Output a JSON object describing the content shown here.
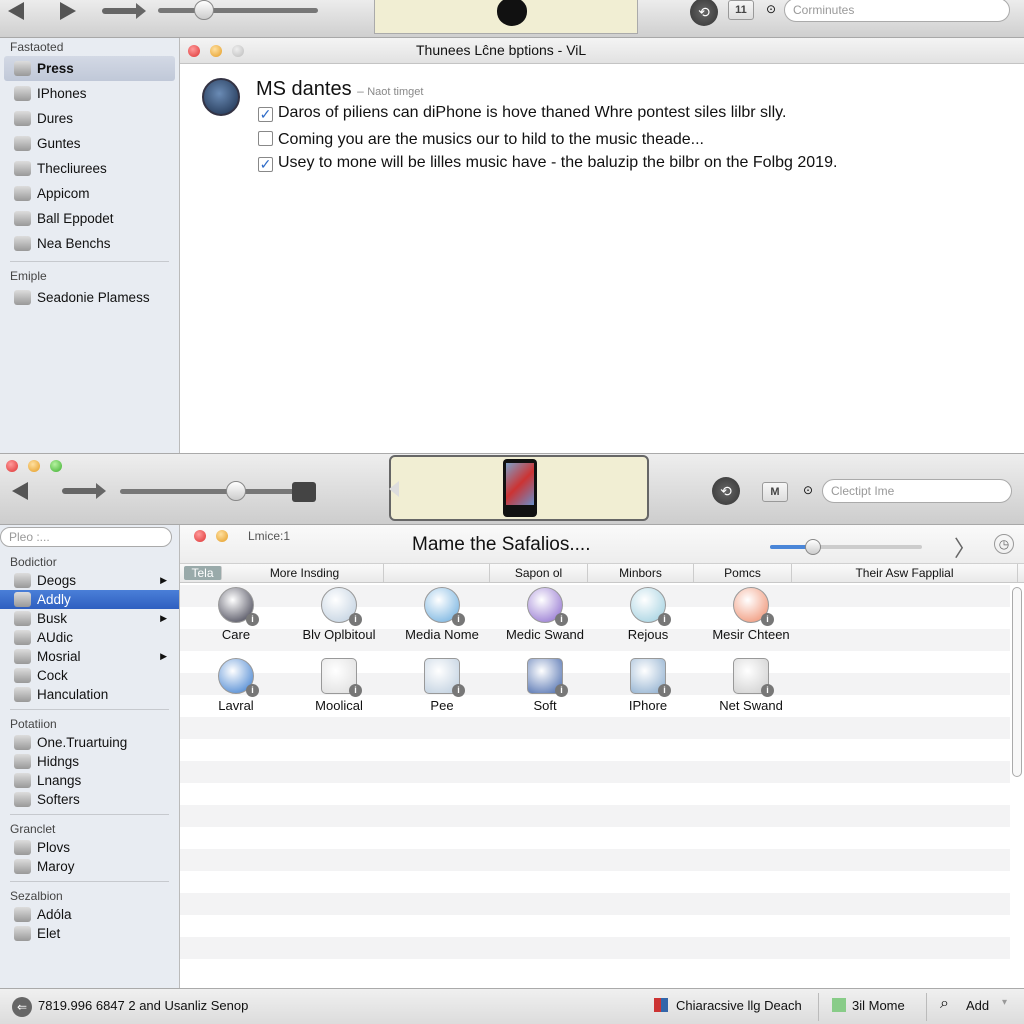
{
  "top_toolbar": {
    "search_placeholder": "Corminutes",
    "view_button_label": "11"
  },
  "sidebar_top": {
    "sections": [
      {
        "header": "Fastaoted",
        "items": [
          {
            "label": "Press",
            "icon": "drive-icon",
            "selected": true
          },
          {
            "label": "IPhones",
            "icon": "phone-icon"
          },
          {
            "label": "Dures",
            "icon": "bag-icon"
          },
          {
            "label": "Guntes",
            "icon": "chart-icon"
          },
          {
            "label": "Thecliurees",
            "icon": "inbox-icon"
          },
          {
            "label": "Appicom",
            "icon": "joystick-icon"
          },
          {
            "label": "Ball Eppodet",
            "icon": "camera-icon"
          },
          {
            "label": "Nea Benchs",
            "icon": "github-icon"
          }
        ]
      },
      {
        "header": "Emiple",
        "items": [
          {
            "label": "Seadonie Plamess",
            "icon": "dollar-icon"
          }
        ]
      }
    ]
  },
  "upper_window": {
    "title": "Thunees Lĉne bptions  -  ViL",
    "heading": "MS dantes",
    "subheading": "Naot timget",
    "options": [
      {
        "label": "Daros of piliens can diPhone is hove thaned Whre pontest siles lilbr slly.",
        "checked": true
      },
      {
        "label": "Coming you are the musics our to hild to the music theade...",
        "checked": false
      },
      {
        "label": "Usey to mone will be lilles music have - the baluzip the bilbr on the Folbg 2019.",
        "checked": true
      }
    ]
  },
  "lower_toolbar": {
    "search_placeholder": "Clectipt Ime",
    "view_button_label": "M"
  },
  "sidebar_bottom": {
    "search_placeholder": "Pleo :...",
    "sections": [
      {
        "header": "Bodictior",
        "items": [
          {
            "label": "Deogs",
            "icon": "keyboard-icon",
            "submenu": true
          },
          {
            "label": "Addly",
            "icon": "document-icon",
            "selected": true
          },
          {
            "label": "Busk",
            "icon": "box-icon",
            "submenu": true
          },
          {
            "label": "AUdic",
            "icon": "audio-icon"
          },
          {
            "label": "Mosrial",
            "icon": "disk-icon",
            "submenu": true
          },
          {
            "label": "Cock",
            "icon": "app-icon"
          },
          {
            "label": "Hanculation",
            "icon": "device-icon"
          }
        ]
      },
      {
        "header": "Potatiion",
        "items": [
          {
            "label": "One.Truartuing",
            "icon": "network-icon"
          },
          {
            "label": "Hidngs",
            "icon": "globe-icon"
          },
          {
            "label": "Lnangs",
            "icon": "display-icon"
          },
          {
            "label": "Softers",
            "icon": "folder-icon"
          }
        ]
      },
      {
        "header": "Granclet",
        "items": [
          {
            "label": "Plovs",
            "icon": "tower-icon"
          },
          {
            "label": "Maroy",
            "icon": "card-icon"
          }
        ]
      },
      {
        "header": "Sezalbion",
        "items": [
          {
            "label": "Adóla",
            "icon": "folder-icon"
          },
          {
            "label": "Elet",
            "icon": "location-pin-icon"
          }
        ]
      }
    ]
  },
  "lower_window": {
    "counter_label": "Lmice:1",
    "title": "Mame the Safalios....",
    "zoom_slider_value": 0.28,
    "columns": [
      "Tela",
      "More Insding",
      "",
      "Sapon ol",
      "Minbors",
      "Pomcs",
      "Their Asw Fapplial"
    ],
    "grid": [
      {
        "label": "Care",
        "icon": "globe-icon"
      },
      {
        "label": "Blv Oplbitoul",
        "icon": "folder-icon"
      },
      {
        "label": "Media Nome",
        "icon": "media-icon"
      },
      {
        "label": "Medic Swand",
        "icon": "shield-icon"
      },
      {
        "label": "Rejous",
        "icon": "radar-icon"
      },
      {
        "label": "Mesir Chteen",
        "icon": "color-wheel-icon"
      },
      {
        "label": "Lavral",
        "icon": "music-note-icon"
      },
      {
        "label": "Moolical",
        "icon": "list-icon"
      },
      {
        "label": "Pee",
        "icon": "script-icon"
      },
      {
        "label": "Soft",
        "icon": "laptop-icon"
      },
      {
        "label": "IPhore",
        "icon": "shield-icon"
      },
      {
        "label": "Net Swand",
        "icon": "drive-icon"
      }
    ]
  },
  "status_bar": {
    "left_text": "7819.996 6847 2 and Usanliz Senop",
    "items": [
      "Chiaracsive llg Deach",
      "3il Mome",
      "Add"
    ]
  },
  "colors": {
    "selection_blue": "#3466c8",
    "lcd_background": "#f1eed3",
    "check_blue": "#2f6cc8"
  }
}
